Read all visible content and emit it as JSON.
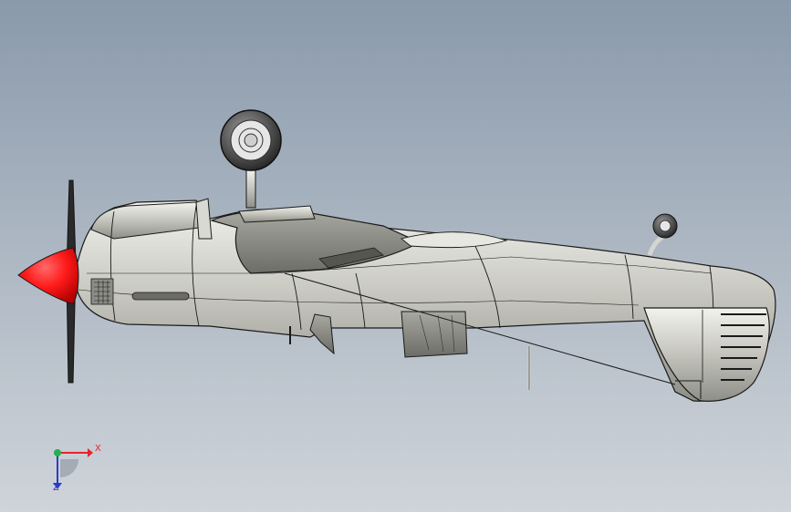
{
  "viewport": {
    "background_top": "#8a99ab",
    "background_bottom": "#cfd4da"
  },
  "model": {
    "body_color": "#bfc0b6",
    "spinner_color": "#ff1a1a",
    "edge_color": "#1a1a1a"
  },
  "triad": {
    "x_label": "X",
    "z_label": "Z",
    "x_color": "#e8232b",
    "y_color": "#22b14c",
    "z_color": "#2b3cc8"
  }
}
